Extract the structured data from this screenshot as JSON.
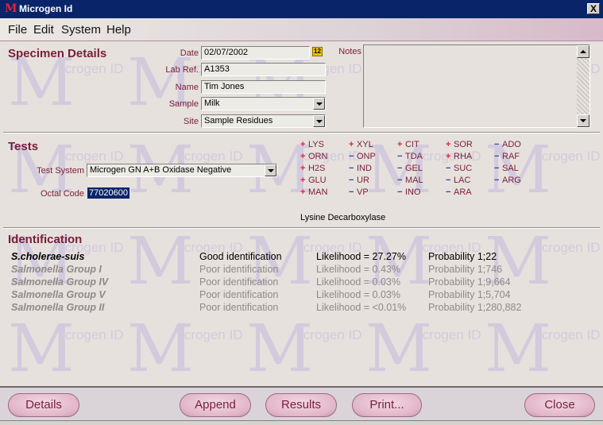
{
  "window": {
    "title": "Microgen Id",
    "close_glyph": "X"
  },
  "menu": [
    "File",
    "Edit",
    "System",
    "Help"
  ],
  "watermark_text": "icrogen ID",
  "specimen": {
    "heading": "Specimen Details",
    "date_label": "Date",
    "date_value": "02/07/2002",
    "labref_label": "Lab Ref.",
    "labref_value": "A1353",
    "name_label": "Name",
    "name_value": "Tim Jones",
    "sample_label": "Sample",
    "sample_value": "Milk",
    "site_label": "Site",
    "site_value": "Sample Residues",
    "notes_label": "Notes",
    "calendar_icon_text": "12"
  },
  "tests": {
    "heading": "Tests",
    "system_label": "Test System",
    "system_value": "Microgen GN A+B Oxidase Negative",
    "octal_label": "Octal Code",
    "octal_value": "77020600",
    "hover_description": "Lysine Decarboxylase",
    "columns": [
      [
        {
          "sign": "+",
          "code": "LYS"
        },
        {
          "sign": "+",
          "code": "ORN"
        },
        {
          "sign": "+",
          "code": "H2S"
        },
        {
          "sign": "+",
          "code": "GLU"
        },
        {
          "sign": "+",
          "code": "MAN"
        }
      ],
      [
        {
          "sign": "+",
          "code": "XYL"
        },
        {
          "sign": "−",
          "code": "ONP"
        },
        {
          "sign": "−",
          "code": "IND"
        },
        {
          "sign": "−",
          "code": "UR"
        },
        {
          "sign": "−",
          "code": "VP"
        }
      ],
      [
        {
          "sign": "+",
          "code": "CIT"
        },
        {
          "sign": "−",
          "code": "TDA"
        },
        {
          "sign": "−",
          "code": "GEL"
        },
        {
          "sign": "−",
          "code": "MAL"
        },
        {
          "sign": "−",
          "code": "INO"
        }
      ],
      [
        {
          "sign": "+",
          "code": "SOR"
        },
        {
          "sign": "+",
          "code": "RHA"
        },
        {
          "sign": "−",
          "code": "SUC"
        },
        {
          "sign": "−",
          "code": "LAC"
        },
        {
          "sign": "−",
          "code": "ARA"
        }
      ],
      [
        {
          "sign": "−",
          "code": "ADO"
        },
        {
          "sign": "−",
          "code": "RAF"
        },
        {
          "sign": "−",
          "code": "SAL"
        },
        {
          "sign": "−",
          "code": "ARG"
        }
      ]
    ]
  },
  "identification": {
    "heading": "Identification",
    "results": [
      {
        "organism": "S.cholerae-suis",
        "identification": "Good identification",
        "likelihood": "Likelihood = 27.27%",
        "probability": "Probability 1;22",
        "rank": "best"
      },
      {
        "organism": "Salmonella Group I",
        "identification": "Poor identification",
        "likelihood": "Likelihood = 0.43%",
        "probability": "Probability 1;746",
        "rank": "poor"
      },
      {
        "organism": "Salmonella Group IV",
        "identification": "Poor identification",
        "likelihood": "Likelihood = 0.03%",
        "probability": "Probability 1;9,664",
        "rank": "poor"
      },
      {
        "organism": "Salmonella Group V",
        "identification": "Poor identification",
        "likelihood": "Likelihood = 0.03%",
        "probability": "Probability 1;5,704",
        "rank": "poor"
      },
      {
        "organism": "Salmonella Group II",
        "identification": "Poor identification",
        "likelihood": "Likelihood = <0.01%",
        "probability": "Probability 1;280,882",
        "rank": "poor"
      }
    ]
  },
  "buttons": {
    "details": "Details",
    "append": "Append",
    "results": "Results",
    "print": "Print...",
    "close": "Close"
  },
  "colors": {
    "accent": "#7a1e3a",
    "positive": "#e0243a",
    "negative": "#2c3ea8",
    "titlebar": "#0a246a"
  }
}
